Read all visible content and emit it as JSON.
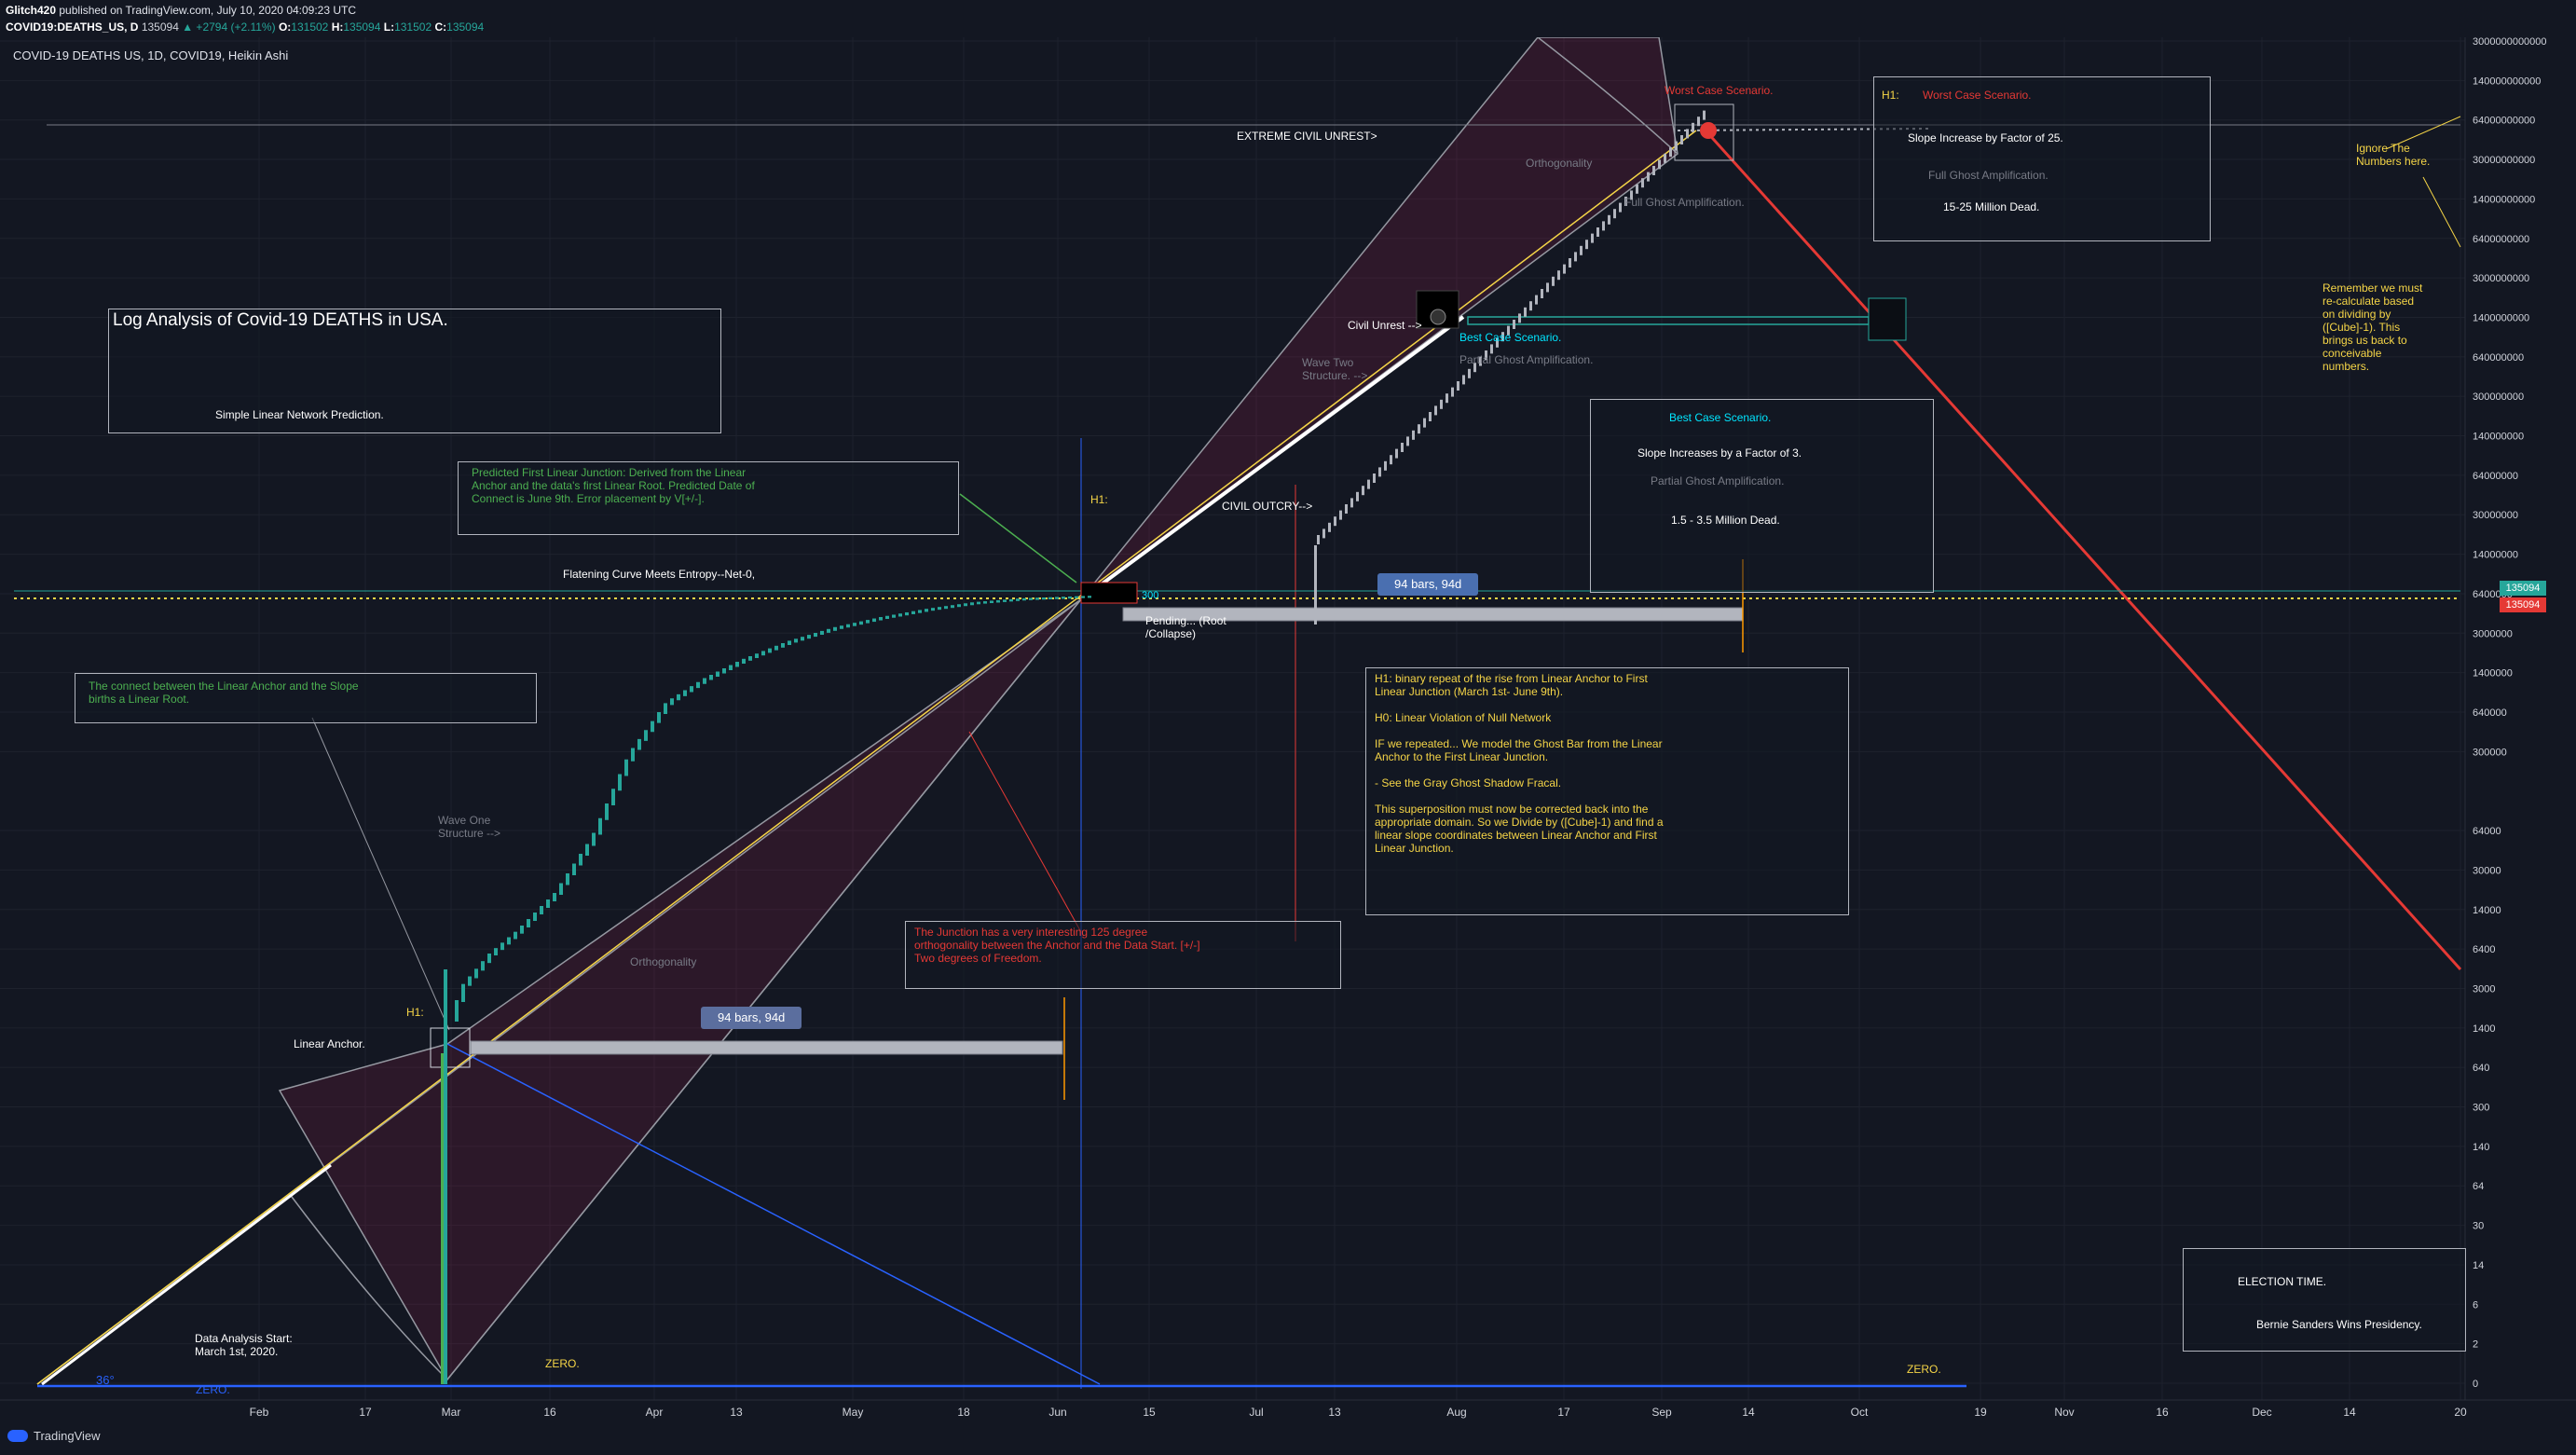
{
  "header": {
    "author": "Glitch420",
    "published": "published on TradingView.com, July 10, 2020 04:09:23 UTC",
    "symbol": "COVID19:DEATHS_US, D",
    "last": "135094",
    "change": "▲ +2794 (+2.11%)",
    "o_label": "O:",
    "o": "131502",
    "h_label": "H:",
    "h": "135094",
    "l_label": "L:",
    "l": "131502",
    "c_label": "C:",
    "c": "135094",
    "chart_title": "COVID-19 DEATHS US, 1D, COVID19, Heikin Ashi"
  },
  "footer": {
    "logo_text": "TradingView"
  },
  "price_tags": {
    "top": "135094",
    "bottom": "135094"
  },
  "annotations": {
    "log_title": "Log Analysis of Covid-19 DEATHS in USA.",
    "log_sub": "Simple Linear Network Prediction.",
    "predicted": "Predicted First Linear Junction: Derived from the Linear\nAnchor and the data's first Linear Root. Predicted Date of\nConnect is June 9th. Error placement by V[+/-].",
    "connect": "The connect between the Linear Anchor and the Slope\nbirths a Linear Root.",
    "junction": "The Junction has a very interesting 125 degree\northogonality between the Anchor and the Data Start. [+/-]\nTwo degrees of Freedom.",
    "h1_block": "H1: binary repeat of the rise from Linear Anchor to First\nLinear Junction (March 1st- June 9th).\n\nH0: Linear Violation of Null Network\n\nIF we repeated... We model the Ghost Bar from the Linear\nAnchor to the First Linear Junction.\n\n- See the Gray Ghost Shadow Fracal.\n\nThis superposition must now be corrected back into the\nappropriate domain. So we Divide by ([Cube]-1) and find a\nlinear slope coordinates between Linear Anchor and First\nLinear Junction.",
    "best_title": "Best Case Scenario.",
    "best_slope": "Slope Increases by a Factor of 3.",
    "best_partial": "Partial Ghost Amplification.",
    "best_dead": "1.5 - 3.5 Million Dead.",
    "worst_h1": "H1:",
    "worst_title": "Worst Case Scenario.",
    "worst_slope": "Slope Increase by Factor of 25.",
    "worst_full": "Full Ghost Amplification.",
    "worst_dead": "15-25 Million Dead.",
    "election_title": "ELECTION TIME.",
    "election_sub": "Bernie Sanders Wins Presidency.",
    "ignore": "Ignore The\nNumbers here.",
    "remember": "Remember we must\nre-calculate based\non dividing by\n([Cube]-1). This\nbrings us back to\nconceivable\nnumbers.",
    "extreme": "EXTREME CIVIL UNREST>",
    "worst_top": "Worst Case Scenario.",
    "orth_top": "Orthogonality",
    "full_ghost": "Full Ghost Amplification.",
    "civil_unrest": "Civil Unrest -->",
    "best_cyan": "Best Case Scenario.",
    "partial_ghost": "Partial Ghost Amplification.",
    "wave_two": "Wave Two\nStructure. -->",
    "civil_outcry": "CIVIL OUTCRY-->",
    "h1_mid": "H1:",
    "flatening": "Flatening Curve Meets Entropy--Net-0,",
    "pending": "Pending... (Root\n/Collapse)",
    "wave_one": "Wave One\nStructure -->",
    "orth_low": "Orthogonality",
    "h1_low": "H1:",
    "linear_anchor": "Linear Anchor.",
    "data_start": "Data Analysis Start:\nMarch 1st, 2020.",
    "zero_a": "ZERO.",
    "zero_b": "ZERO.",
    "zero_c": "ZERO.",
    "deg36": "36°",
    "bars_1": "94 bars, 94d",
    "bars_2": "94 bars, 94d",
    "label_300": "300"
  },
  "colors": {
    "background": "#131722",
    "up": "#26a69a",
    "ghost": "#b2b5be",
    "red_line": "#e53935",
    "blue_line": "#2962ff",
    "yellow_dots": "#f5d547"
  },
  "chart_data": {
    "type": "candlestick",
    "style": "Heikin Ashi",
    "y_scale": "log",
    "grid": true,
    "x_ticks": [
      "Feb",
      "17",
      "Mar",
      "16",
      "Apr",
      "13",
      "May",
      "18",
      "Jun",
      "15",
      "Jul",
      "13",
      "Aug",
      "17",
      "Sep",
      "14",
      "Oct",
      "19",
      "Nov",
      "16",
      "Dec",
      "14",
      "20"
    ],
    "y_ticks": [
      "3000000000000",
      "140000000000",
      "64000000000",
      "30000000000",
      "14000000000",
      "6400000000",
      "3000000000",
      "1400000000",
      "640000000",
      "300000000",
      "140000000",
      "64000000",
      "30000000",
      "14000000",
      "6400000",
      "3000000",
      "1400000",
      "640000",
      "300000",
      "135094",
      "64000",
      "30000",
      "14000",
      "6400",
      "3000",
      "1400",
      "640",
      "300",
      "140",
      "64",
      "30",
      "14",
      "6",
      "2",
      "0"
    ],
    "last_price": 135094,
    "series": [
      {
        "name": "",
        "dates": [
          "2020-03-01",
          "2020-03-15",
          "2020-04-01",
          "2020-04-15",
          "2020-05-01",
          "2020-05-15",
          "2020-06-01",
          "2020-06-15",
          "2020-07-01",
          "2020-07-10"
        ],
        "values": [
          1,
          60,
          5000,
          28000,
          64000,
          88000,
          106000,
          117000,
          127000,
          135094
        ]
      }
    ]
  }
}
